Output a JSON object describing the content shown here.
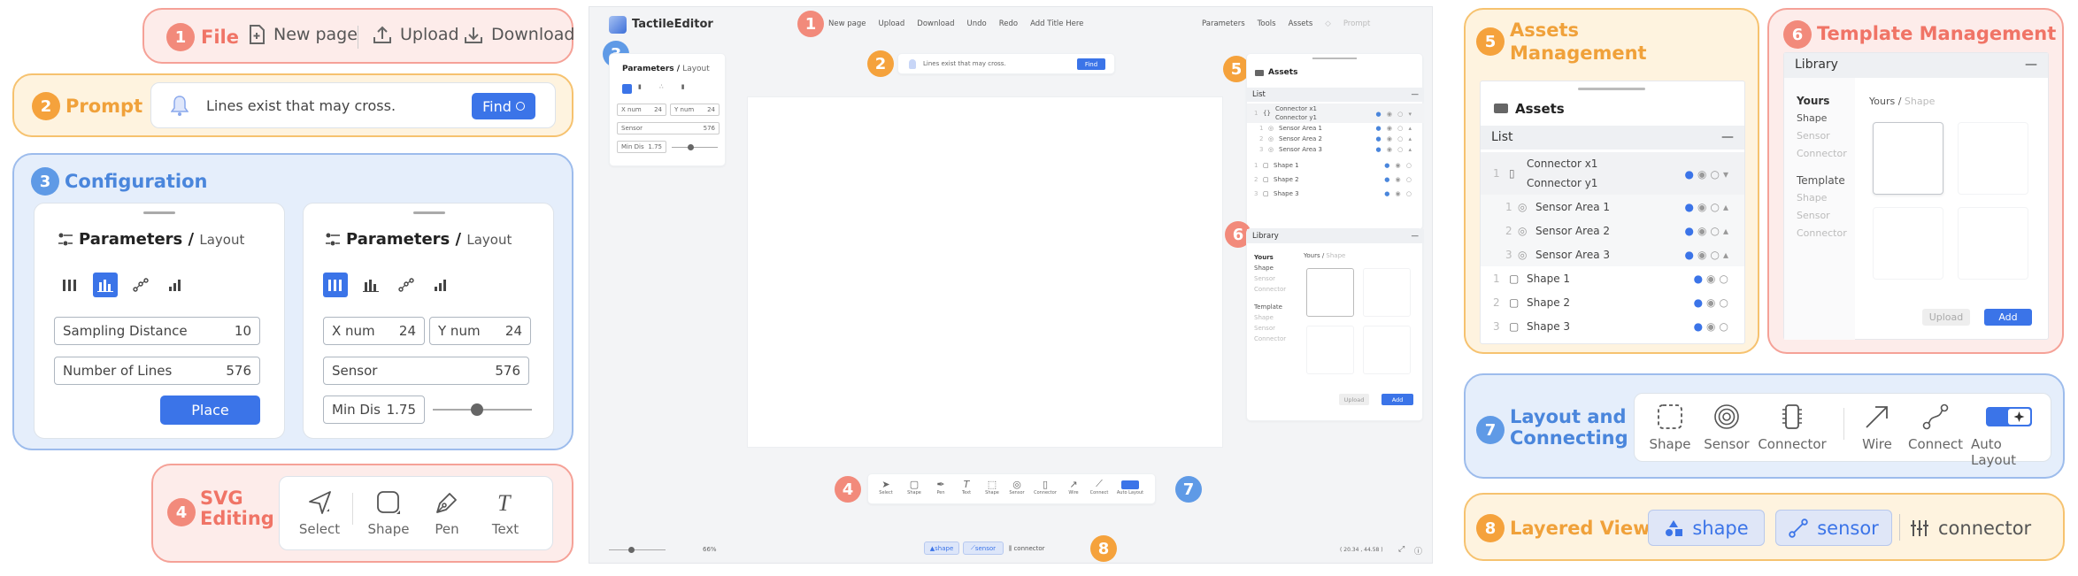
{
  "colors": {
    "accent": "#3b74e8",
    "red": "#f07466",
    "orange": "#f0a13a",
    "blue": "#4a86dc"
  },
  "file": {
    "num": "1",
    "title": "File",
    "new_page": "New page",
    "upload": "Upload",
    "download": "Download"
  },
  "prompt": {
    "num": "2",
    "title": "Prompt",
    "text": "Lines exist that may cross.",
    "find": "Find"
  },
  "config": {
    "num": "3",
    "title": "Configuration",
    "card1": {
      "title": "Parameters /",
      "sub": "Layout",
      "f1_label": "Sampling Distance",
      "f1_value": "10",
      "f2_label": "Number of Lines",
      "f2_value": "576",
      "place": "Place"
    },
    "card2": {
      "title": "Parameters /",
      "sub": "Layout",
      "xnum_label": "X num",
      "xnum_value": "24",
      "ynum_label": "Y num",
      "ynum_value": "24",
      "sensor_label": "Sensor",
      "sensor_value": "576",
      "mindis_label": "Min Dis",
      "mindis_value": "1.75",
      "slider_value": 0.45
    }
  },
  "svg": {
    "num": "4",
    "title1": "SVG",
    "title2": "Editing",
    "tools": [
      "Select",
      "Shape",
      "Pen",
      "Text"
    ]
  },
  "editor": {
    "app_title": "TactileEditor",
    "menu": [
      "New page",
      "Upload",
      "Download",
      "Undo",
      "Redo",
      "Add Title Here"
    ],
    "right_menu": [
      "Parameters",
      "Tools",
      "Assets",
      "",
      "Prompt"
    ],
    "prompt_text": "Lines exist that may cross.",
    "find": "Find",
    "param_title": "Parameters /",
    "param_sub": "Layout",
    "xnum": "X num",
    "xnum_v": "24",
    "ynum": "Y num",
    "ynum_v": "24",
    "sensor": "Sensor",
    "sensor_v": "576",
    "mindis": "Min Dis",
    "mindis_v": "1.75",
    "assets": "Assets",
    "list": "List",
    "library": "Library",
    "assets_rows": [
      {
        "n": "1",
        "t": "Connector x1"
      },
      {
        "n": "",
        "t": "Connector y1"
      },
      {
        "n": "1",
        "t": "Sensor Area 1"
      },
      {
        "n": "2",
        "t": "Sensor Area 2"
      },
      {
        "n": "3",
        "t": "Sensor Area 3"
      },
      {
        "n": "1",
        "t": "Shape 1"
      },
      {
        "n": "2",
        "t": "Shape 2"
      },
      {
        "n": "3",
        "t": "Shape 3"
      }
    ],
    "lib_side": {
      "yours": "Yours",
      "s1": "Shape",
      "s2": "Sensor",
      "s3": "Connector",
      "template": "Template",
      "t1": "Shape",
      "t2": "Sensor",
      "t3": "Connector"
    },
    "lib_path": "Yours /",
    "lib_path2": "Shape",
    "upload": "Upload",
    "add": "Add",
    "tools": [
      "Select",
      "Shape",
      "Pen",
      "Text",
      "Shape",
      "Sensor",
      "Connector",
      "Wire",
      "Connect",
      "Auto Layout"
    ],
    "zoom": "66%",
    "layers": [
      "shape",
      "sensor",
      "connector"
    ],
    "coords": "( 20.34 , 44.58 )",
    "badges": [
      "1",
      "2",
      "3",
      "4",
      "5",
      "6",
      "7",
      "8"
    ]
  },
  "assets": {
    "num": "5",
    "title1": "Assets",
    "title2": "Management",
    "header": "Assets",
    "list": "List",
    "rows": [
      {
        "n": "1",
        "t": "Connector x1"
      },
      {
        "n": "",
        "t": "Connector y1"
      },
      {
        "n": "1",
        "t": "Sensor Area 1"
      },
      {
        "n": "2",
        "t": "Sensor Area 2"
      },
      {
        "n": "3",
        "t": "Sensor Area 3"
      },
      {
        "n": "1",
        "t": "Shape 1"
      },
      {
        "n": "2",
        "t": "Shape 2"
      },
      {
        "n": "3",
        "t": "Shape 3"
      }
    ]
  },
  "template": {
    "num": "6",
    "title": "Template Management",
    "library": "Library",
    "yours": "Yours",
    "y1": "Shape",
    "y2": "Sensor",
    "y3": "Connector",
    "tpl": "Template",
    "t1": "Shape",
    "t2": "Sensor",
    "t3": "Connector",
    "path": "Yours /",
    "path2": "Shape",
    "upload": "Upload",
    "add": "Add"
  },
  "layout": {
    "num": "7",
    "title1": "Layout and",
    "title2": "Connecting",
    "tools": [
      "Shape",
      "Sensor",
      "Connector",
      "Wire",
      "Connect",
      "Auto Layout"
    ]
  },
  "layered": {
    "num": "8",
    "title": "Layered View",
    "items": [
      "shape",
      "sensor",
      "connector"
    ]
  }
}
